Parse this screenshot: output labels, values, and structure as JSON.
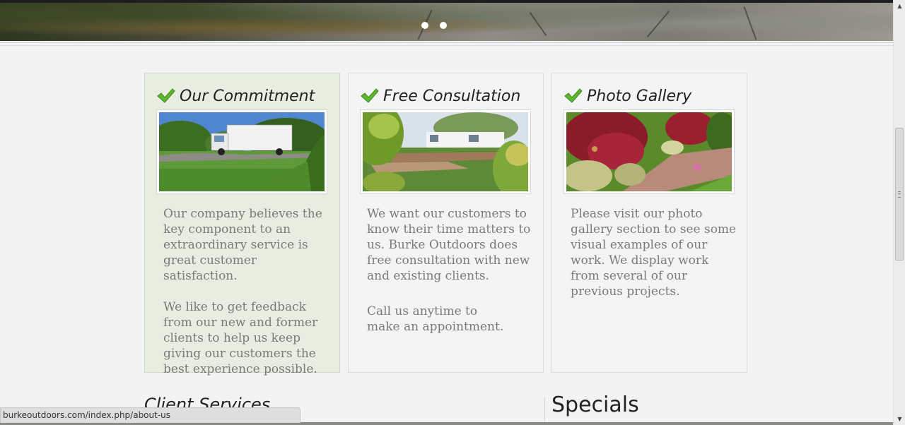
{
  "hero": {
    "slide_count": 2
  },
  "cards": [
    {
      "title": "Our Commitment",
      "paragraphs": [
        "Our company believes the key component to an extraordinary service is great customer satisfaction.",
        "We like to get feedback from our new and former clients to help us keep giving our customers the best experience possible."
      ]
    },
    {
      "title": "Free Consultation",
      "paragraphs": [
        "We want our customers to know their time matters to us. Burke Outdoors does free consultation with new and existing clients.",
        "Call us anytime to make an appointment."
      ]
    },
    {
      "title": "Photo Gallery",
      "paragraphs": [
        "Please visit our photo gallery section to see some visual examples of our work. We display work from several of our previous projects."
      ]
    }
  ],
  "sections": {
    "client_services": "Client Services",
    "specials": "Specials"
  },
  "status_bar": {
    "url": "burkeoutdoors.com/index.php/about-us"
  },
  "scrollbar": {
    "up_arrow": "▲",
    "down_arrow": "▼"
  },
  "colors": {
    "check_green": "#5cb82c",
    "active_card_bg": "#e8ede2",
    "body_text": "#7a7a7a"
  }
}
